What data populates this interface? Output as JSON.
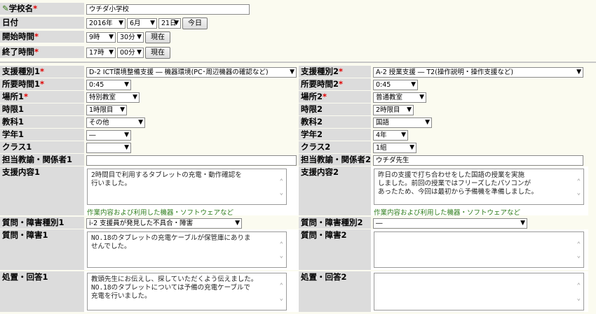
{
  "school": {
    "label": "学校名",
    "value": "ウチダ小学校"
  },
  "date": {
    "label": "日付",
    "year": "2016年",
    "month": "6月",
    "day": "21日",
    "now_button": "今日"
  },
  "start_time": {
    "label": "開始時間",
    "hour": "9時",
    "minute": "30分",
    "now_button": "現在"
  },
  "end_time": {
    "label": "終了時間",
    "hour": "17時",
    "minute": "00分",
    "now_button": "現在"
  },
  "required_mark": "*",
  "col1": {
    "support_type_label": "支援種別1",
    "support_type": "D-2 ICT環境整備支援 ― 機器環境(PC･周辺機器の確認など)",
    "duration_label": "所要時間1",
    "duration": "0:45",
    "place_label": "場所1",
    "place": "特別教室",
    "period_label": "時限1",
    "period": "1時限目",
    "subject_label": "教科1",
    "subject": "その他",
    "grade_label": "学年1",
    "grade": "―",
    "class_label": "クラス1",
    "class": "",
    "teacher_label": "担当教諭・関係者1",
    "teacher": "",
    "content_label": "支援内容1",
    "content": "2時間目で利用するタブレットの充電・動作確認を\n行いました。",
    "content_hint": "作業内容および利用した機器・ソフトウェアなど",
    "issue_type_label": "質問・障害種別1",
    "issue_type": "i-2 支援員が発見した不具合・障害",
    "issue_label": "質問・障害1",
    "issue": "NO.18のタブレットの充電ケーブルが保管庫にありま\nせんでした。",
    "action_label": "処置・回答1",
    "action": "教頭先生にお伝えし、探していただくよう伝えました。\nNO.18のタブレットについては予備の充電ケーブルで\n充電を行いました。"
  },
  "col2": {
    "support_type_label": "支援種別2",
    "support_type": "A-2 授業支援 ― T2(操作説明・操作支援など)",
    "duration_label": "所要時間2",
    "duration": "0:45",
    "place_label": "場所2",
    "place": "普通教室",
    "period_label": "時限2",
    "period": "2時限目",
    "subject_label": "教科2",
    "subject": "国語",
    "grade_label": "学年2",
    "grade": "4年",
    "class_label": "クラス2",
    "class": "1組",
    "teacher_label": "担当教諭・関係者2",
    "teacher": "ウチダ先生",
    "content_label": "支援内容2",
    "content": "昨日の支援で打ち合わせをした国語の授業を実施\nしました。前回の授業ではフリーズしたパソコンが\nあったため、今回は最初から予備機を準備しました。",
    "content_hint": "作業内容および利用した機器・ソフトウェアなど",
    "issue_type_label": "質問・障害種別2",
    "issue_type": "―",
    "issue_label": "質問・障害2",
    "issue": "",
    "action_label": "処置・回答2",
    "action": ""
  },
  "icons": {
    "pencil": "pencil-icon",
    "dropdown": "chevron-down-icon"
  },
  "colors": {
    "label_bg": "#dcdcdc",
    "required": "#e00000",
    "hint": "#2e7d1a",
    "page_bg": "#fbfbf0"
  }
}
